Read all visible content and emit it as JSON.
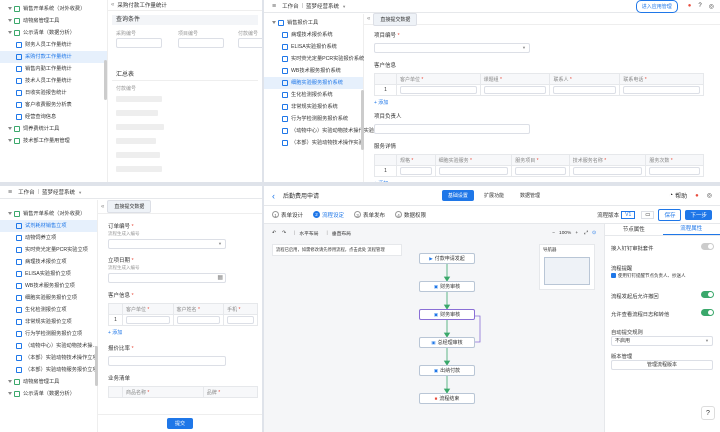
{
  "tl": {
    "sidebar": [
      {
        "label": "销售开单系统（对外收费）",
        "level": 0,
        "kind": "folder"
      },
      {
        "label": "动物房管理工具",
        "level": 0,
        "kind": "folder"
      },
      {
        "label": "公示清单（数据分析）",
        "level": 0,
        "kind": "folder"
      },
      {
        "label": "财务人员工作量统计",
        "level": 1,
        "kind": "doc"
      },
      {
        "label": "采购付款工作量统计",
        "level": 1,
        "kind": "doc",
        "active": true
      },
      {
        "label": "销售内勤工作量统计",
        "level": 1,
        "kind": "doc"
      },
      {
        "label": "技术人员工作量统计",
        "level": 1,
        "kind": "doc"
      },
      {
        "label": "日收实验报告统计",
        "level": 1,
        "kind": "doc"
      },
      {
        "label": "客户收费服务分析表",
        "level": 1,
        "kind": "doc"
      },
      {
        "label": "经营查询信息",
        "level": 1,
        "kind": "doc"
      },
      {
        "label": "饲养费统计工具",
        "level": 0,
        "kind": "folder"
      },
      {
        "label": "技术部工作量用管理",
        "level": 0,
        "kind": "folder"
      }
    ],
    "page_title": "采购付款工作量统计",
    "query_title": "查询条件",
    "fields": [
      "采购编号",
      "项目编号",
      "付款编号"
    ],
    "summary_title": "汇总表",
    "col1": "付款编号"
  },
  "tr": {
    "top_nav": {
      "workbench": "工作台",
      "system": "蓝梦经营系统",
      "invite": "进入应用管理"
    },
    "tree_title": "销售报价工具",
    "tree": [
      "病理技术报价系统",
      "ELISA实验报价系统",
      "实时荧光定量PCR实验报价系统",
      "WB技术服务报价系统",
      "细胞实验服务报价系统",
      "生化检测报价系统",
      "非常规实验报价系统",
      "行为学检测服务报价系统",
      "（动物中心）实验动物技术操作实验",
      "（本部）实验动物技术操作实验"
    ],
    "active_index": 4,
    "tab": "直接提交数据",
    "form": {
      "project_no": "项目编号",
      "customer_info": "客户信息",
      "customer_cols": [
        "客户单位",
        "课题组",
        "联系人",
        "联系电话"
      ],
      "row_no": "1",
      "add": "+ 添加",
      "owner": "项目负责人",
      "service": "服务详情",
      "service_cols": [
        "规格",
        "细胞实验服务",
        "服务项目",
        "技术服务名称",
        "服务次数"
      ]
    }
  },
  "bl": {
    "top_nav": {
      "workbench": "工作台",
      "system": "蓝梦经营系统"
    },
    "sidebar": [
      {
        "label": "销售开单系统（对外收费）",
        "level": 0,
        "kind": "folder"
      },
      {
        "label": "试剂耗材销售立项",
        "level": 1,
        "kind": "doc",
        "active": true
      },
      {
        "label": "动物饲养立项",
        "level": 1,
        "kind": "doc"
      },
      {
        "label": "实时荧光定量PCR实验立项",
        "level": 1,
        "kind": "doc"
      },
      {
        "label": "病理技术报价立项",
        "level": 1,
        "kind": "doc"
      },
      {
        "label": "ELISA实验报价立项",
        "level": 1,
        "kind": "doc"
      },
      {
        "label": "WB技术服务报价立项",
        "level": 1,
        "kind": "doc"
      },
      {
        "label": "细胞实验服务报价立项",
        "level": 1,
        "kind": "doc"
      },
      {
        "label": "生化检测报价立项",
        "level": 1,
        "kind": "doc"
      },
      {
        "label": "非常规实验报价立项",
        "level": 1,
        "kind": "doc"
      },
      {
        "label": "行为学检测服务报价立项",
        "level": 1,
        "kind": "doc"
      },
      {
        "label": "（动物中心）实验动物技术操…",
        "level": 1,
        "kind": "doc"
      },
      {
        "label": "（本部）实验动物技术操作立项",
        "level": 1,
        "kind": "doc"
      },
      {
        "label": "（本部）实验动物服务报价立项",
        "level": 1,
        "kind": "doc"
      },
      {
        "label": "动物房管理工具",
        "level": 0,
        "kind": "folder"
      },
      {
        "label": "公示清单（数据分析）",
        "level": 0,
        "kind": "folder"
      }
    ],
    "tab": "直接提交数据",
    "form": {
      "order_no": "订单编号",
      "order_ph": "流程生成入编号",
      "date": "立项日期",
      "date_ph": "流程生成入编号",
      "customer": "客户信息",
      "cols": [
        "客户单位",
        "客户姓名",
        "手机"
      ],
      "row_no": "1",
      "add": "+ 添加",
      "discount": "报价比率",
      "business": "业务清单",
      "biz_cols": [
        "商品名称",
        "品牌"
      ],
      "submit": "提交"
    }
  },
  "br": {
    "title": "后勤费用申请",
    "tabs": [
      "基础设置",
      "扩展功能",
      "数据管理"
    ],
    "help": "帮助",
    "steps": [
      "表单设计",
      "流程设定",
      "表单发布",
      "数据权限"
    ],
    "version_label": "流程版本",
    "version_value": "V1",
    "save": "保存",
    "next": "下一步",
    "toolbar": [
      "水平布局",
      "垂直布局"
    ],
    "zoom": "100%",
    "notice": "流程已启用，如需修改请先停用流程，点击此处 流程管理",
    "notice_link": "流程管理",
    "minimap": "导航器",
    "nodes": [
      "付款申请发起",
      "财务审核",
      "财务审核",
      "总经理审核",
      "出纳付款",
      "流程结束"
    ],
    "right_tabs": [
      "节点属性",
      "流程属性"
    ],
    "props": {
      "dingtalk": "接入钉钉审批套件",
      "remind": "流程提醒",
      "remind_opt": "使用钉钉提醒节点负责人、抄送人",
      "withdraw": "流程发起后允许撤回",
      "view_log": "允许查看流程日志和转他",
      "auto_submit": "自动提交规则",
      "auto_value": "不启用",
      "version_mgmt": "版本管理",
      "version_btn": "管理流程版本"
    }
  },
  "colors": {
    "accent": "#1f77e8",
    "green": "#3aa86b",
    "red": "#e84c3d"
  }
}
